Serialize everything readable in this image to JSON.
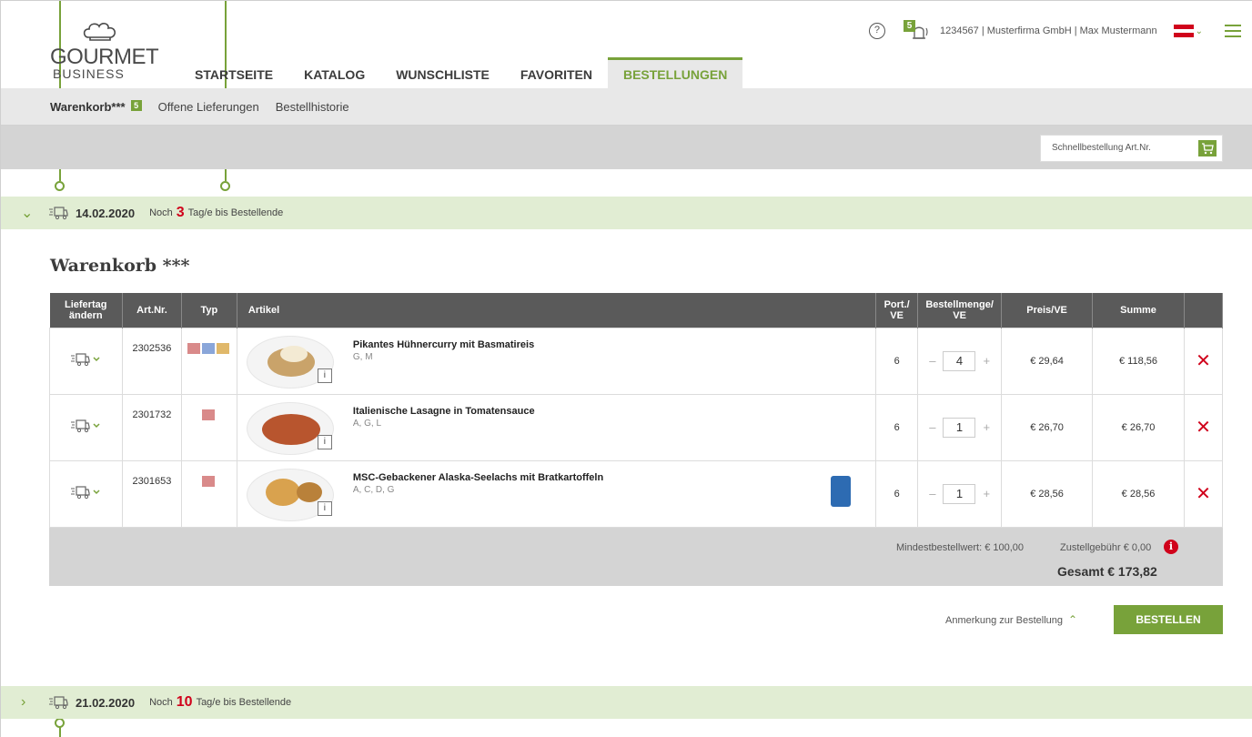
{
  "brand": {
    "word1": "GOURMET",
    "word2": "BUSINESS"
  },
  "nav": {
    "tabs": [
      {
        "label": "STARTSEITE"
      },
      {
        "label": "KATALOG"
      },
      {
        "label": "WUNSCHLISTE"
      },
      {
        "label": "FAVORITEN"
      },
      {
        "label": "BESTELLUNGEN"
      }
    ]
  },
  "header": {
    "help": "?",
    "bell_count": "5",
    "account": "1234567 | Musterfirma GmbH | Max Mustermann"
  },
  "subnav": {
    "items": [
      {
        "label": "Warenkorb***"
      },
      {
        "label": "Offene Lieferungen"
      },
      {
        "label": "Bestellhistorie"
      }
    ],
    "badge": "5"
  },
  "quick": {
    "placeholder": "Schnellbestellung Art.Nr."
  },
  "delivery1": {
    "date": "14.02.2020",
    "pre": "Noch",
    "days": "3",
    "post": "Tag/e bis Bestellende"
  },
  "delivery2": {
    "date": "21.02.2020",
    "pre": "Noch",
    "days": "10",
    "post": "Tag/e bis Bestellende"
  },
  "cart": {
    "title": "Warenkorb ***"
  },
  "table": {
    "headers": {
      "change": "Liefertag ändern",
      "artnr": "Art.Nr.",
      "typ": "Typ",
      "artikel": "Artikel",
      "port": "Port./ VE",
      "qty": "Bestellmenge/ VE",
      "price": "Preis/VE",
      "sum": "Summe"
    },
    "rows": [
      {
        "artnr": "2302536",
        "name": "Pikantes Hühnercurry mit Basmatireis",
        "allergens": "G, M",
        "port": "6",
        "qty": "4",
        "price": "€ 29,64",
        "sum": "€ 118,56"
      },
      {
        "artnr": "2301732",
        "name": "Italienische Lasagne in Tomatensauce",
        "allergens": "A, G, L",
        "port": "6",
        "qty": "1",
        "price": "€ 26,70",
        "sum": "€ 26,70"
      },
      {
        "artnr": "2301653",
        "name": "MSC-Gebackener Alaska-Seelachs mit Bratkartoffeln",
        "allergens": "A, C, D, G",
        "port": "6",
        "qty": "1",
        "price": "€ 28,56",
        "sum": "€ 28,56"
      }
    ],
    "info": "i",
    "minus": "–",
    "plus": "+",
    "del": "✕"
  },
  "summary": {
    "mbw": "Mindestbestellwert: € 100,00",
    "zg": "Zustellgebühr € 0,00",
    "total": "Gesamt € 173,82"
  },
  "actions": {
    "note": "Anmerkung zur Bestellung",
    "order": "BESTELLEN"
  },
  "colors": {
    "accent": "#78a23a",
    "danger": "#d0021b",
    "band": "#e1edd3",
    "headerbg": "#5a5a5a"
  }
}
